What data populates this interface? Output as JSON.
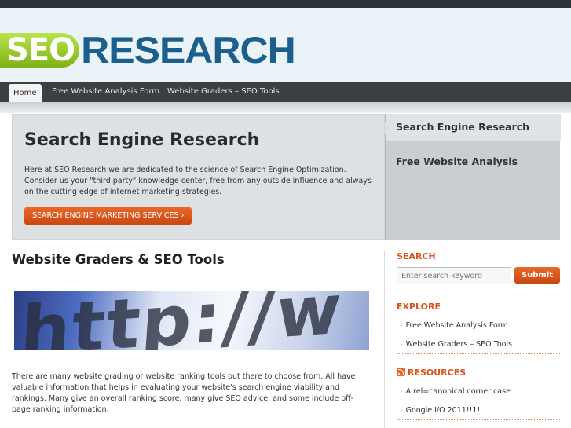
{
  "site": {
    "logo_part1": "SEO",
    "logo_part2": "RESEARCH"
  },
  "nav": {
    "items": [
      {
        "label": "Home"
      },
      {
        "label": "Free Website Analysis Form"
      },
      {
        "label": "Website Graders – SEO Tools"
      }
    ]
  },
  "featured": {
    "title": "Search Engine Research",
    "text": "Here at SEO Research we are dedicated to the science of Search Engine Optimization. Consider us your \"third party\" knowledge center, free from any outside influence and always on the cutting edge of internet marketing strategies.",
    "cta_label": "SEARCH ENGINE MARKETING SERVICES ›",
    "side_items": [
      {
        "label": "Search Engine Research"
      },
      {
        "label": "Free Website Analysis"
      }
    ]
  },
  "main": {
    "title": "Website Graders & SEO Tools",
    "hero_text": "http://w",
    "body": "There are many website grading or website ranking tools out there to choose from. All have valuable information that helps in evaluating your website's search engine viability and rankings. Many give an overall ranking score, many give SEO advice, and some include off-page ranking information."
  },
  "sidebar": {
    "search": {
      "heading": "SEARCH",
      "placeholder": "Enter search keyword",
      "button": "Submit"
    },
    "explore": {
      "heading": "EXPLORE",
      "items": [
        {
          "label": "Free Website Analysis Form"
        },
        {
          "label": "Website Graders – SEO Tools"
        }
      ]
    },
    "resources": {
      "heading": "RESOURCES",
      "items": [
        {
          "label": "A rel=canonical corner case"
        },
        {
          "label": "Google I/O 2011!!1!"
        }
      ]
    }
  },
  "colors": {
    "accent": "#d8561b",
    "nav_bg": "#3b4045",
    "brand_blue": "#1d5f8c",
    "brand_green": "#8cc63f"
  }
}
